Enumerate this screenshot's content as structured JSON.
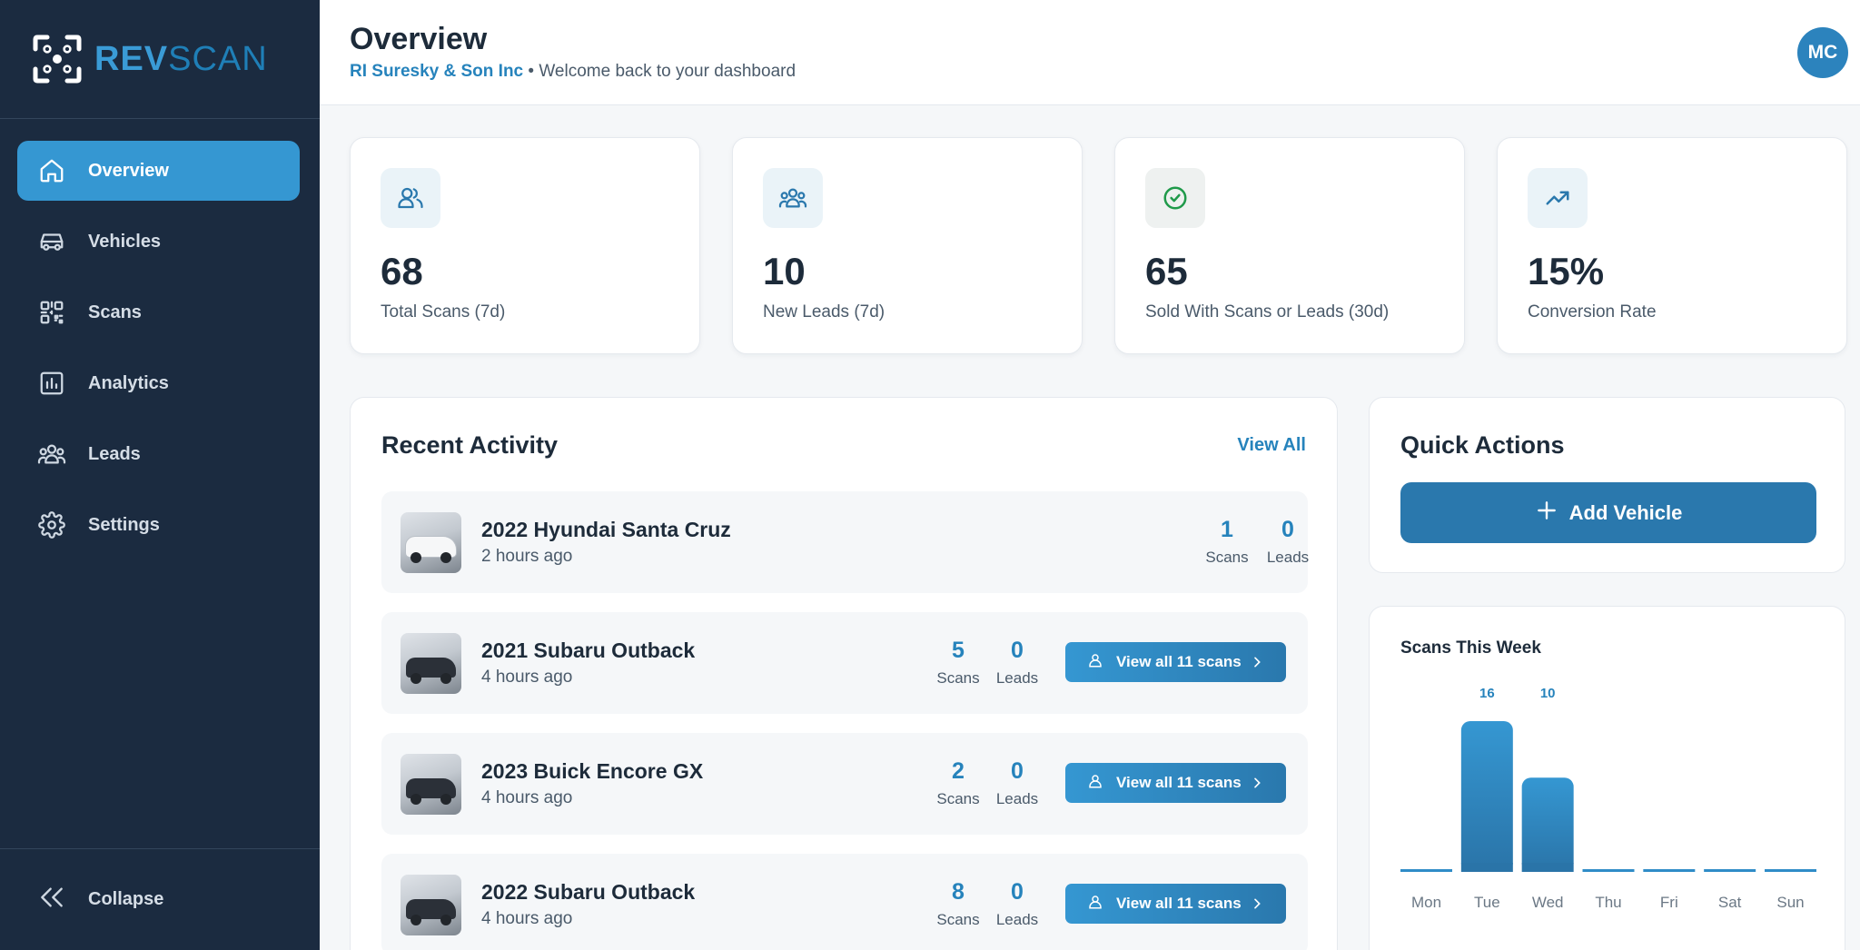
{
  "brand": {
    "name_part1": "REV",
    "name_part2": "SCAN"
  },
  "sidebar": {
    "items": [
      {
        "label": "Overview",
        "icon": "home-icon",
        "active": true
      },
      {
        "label": "Vehicles",
        "icon": "car-icon",
        "active": false
      },
      {
        "label": "Scans",
        "icon": "qr-code-icon",
        "active": false
      },
      {
        "label": "Analytics",
        "icon": "bar-chart-icon",
        "active": false
      },
      {
        "label": "Leads",
        "icon": "users-icon",
        "active": false
      },
      {
        "label": "Settings",
        "icon": "gear-icon",
        "active": false
      }
    ],
    "collapse_label": "Collapse"
  },
  "header": {
    "title": "Overview",
    "company": "RI Suresky & Son Inc",
    "welcome": " • Welcome back to your dashboard",
    "avatar_initials": "MC"
  },
  "stats": [
    {
      "value": "68",
      "label": "Total Scans (7d)",
      "icon": "user-icon"
    },
    {
      "value": "10",
      "label": "New Leads (7d)",
      "icon": "users-icon"
    },
    {
      "value": "65",
      "label": "Sold With Scans or Leads (30d)",
      "icon": "check-circle-icon"
    },
    {
      "value": "15%",
      "label": "Conversion Rate",
      "icon": "trending-up-icon"
    }
  ],
  "recent_activity": {
    "title": "Recent Activity",
    "view_all": "View All",
    "scans_caption": "Scans",
    "leads_caption": "Leads",
    "rows": [
      {
        "vehicle": "2022 Hyundai Santa Cruz",
        "time": "2 hours ago",
        "scans": "1",
        "leads": "0",
        "button": ""
      },
      {
        "vehicle": "2021 Subaru Outback",
        "time": "4 hours ago",
        "scans": "5",
        "leads": "0",
        "button": "View all 11 scans"
      },
      {
        "vehicle": "2023 Buick Encore GX",
        "time": "4 hours ago",
        "scans": "2",
        "leads": "0",
        "button": "View all 11 scans"
      },
      {
        "vehicle": "2022 Subaru Outback",
        "time": "4 hours ago",
        "scans": "8",
        "leads": "0",
        "button": "View all 11 scans"
      }
    ]
  },
  "quick_actions": {
    "title": "Quick Actions",
    "add_vehicle": "Add Vehicle"
  },
  "chart_data": {
    "type": "bar",
    "title": "Scans This Week",
    "categories": [
      "Mon",
      "Tue",
      "Wed",
      "Thu",
      "Fri",
      "Sat",
      "Sun"
    ],
    "values": [
      0,
      16,
      10,
      0,
      0,
      0,
      0
    ],
    "data_labels": [
      "",
      "16",
      "10",
      "",
      "",
      "",
      ""
    ],
    "xlabel": "",
    "ylabel": "",
    "ylim": [
      0,
      16
    ],
    "grid": false,
    "color": "#2f8cc7"
  },
  "colors": {
    "accent": "#3597d2",
    "sidebar": "#1b2b40",
    "link": "#2683bc"
  }
}
